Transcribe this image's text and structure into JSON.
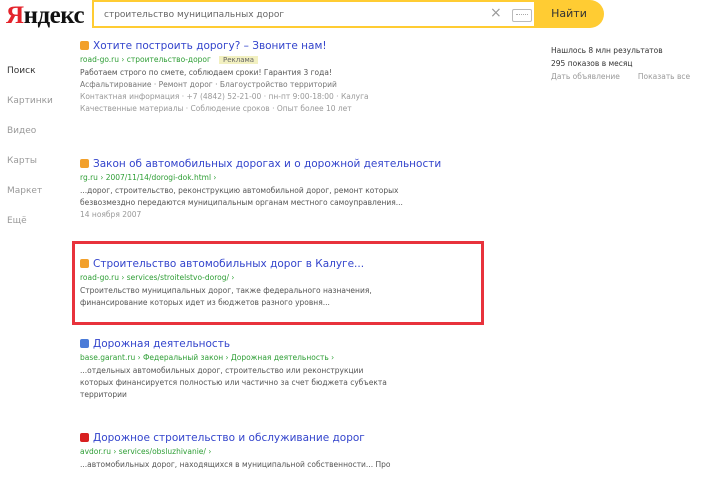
{
  "header": {
    "logo": "Яндекс",
    "search_value": "строительство муниципальных дорог",
    "search_button": "Найти"
  },
  "nav": [
    "Поиск",
    "Картинки",
    "Видео",
    "Карты",
    "Маркет",
    "Ещё"
  ],
  "side": {
    "line1": "Нашлось 8 млн результатов",
    "line2": "295 показов в месяц",
    "link1": "Дать объявление",
    "link2": "Показать все"
  },
  "results": [
    {
      "title": "Хотите построить дорогу? – Звоните нам!",
      "url": "road-go.ru › строительство-дорог",
      "badge": "Реклама",
      "desc": [
        "Работаем строго по смете, соблюдаем сроки! Гарантия 3 года!",
        "Асфальтирование · Ремонт дорог · Благоустройство территорий",
        "Контактная информация · +7 (4842) 52-21-00 · пн-пт 9:00-18:00 · Калуга",
        "Качественные материалы · Соблюдение сроков · Опыт более 10 лет"
      ],
      "favicon": "#f2a02b"
    },
    {
      "title": "Закон об автомобильных дорогах и о дорожной деятельности",
      "url": "rg.ru › 2007/11/14/dorogi-dok.html ›",
      "desc": [
        "...дорог, строительство, реконструкцию автомобильной дорог, ремонт которых",
        "безвозмездно передаются муниципальным органам местного самоуправления..."
      ],
      "date": "14 ноября 2007",
      "favicon": "#f2a02b"
    },
    {
      "title": "Строительство автомобильных дорог в Калуге...",
      "url": "road-go.ru › services/stroitelstvo-dorog/ ›",
      "desc": [
        "Строительство муниципальных дорог, также федерального назначения,",
        "финансирование которых идет из бюджетов разного уровня..."
      ],
      "favicon": "#f2a02b"
    },
    {
      "title": "Дорожная деятельность",
      "url": "base.garant.ru › Федеральный закон › Дорожная деятельность ›",
      "desc": [
        "...отдельных автомобильных дорог, строительство или реконструкции",
        "которых финансируется полностью или частично за счет бюджета субъекта",
        "территории"
      ],
      "favicon": "#4a7bd8"
    },
    {
      "title": "Дорожное строительство и обслуживание дорог",
      "url": "avdor.ru › services/obsluzhivanie/ ›",
      "desc": [
        "...автомобильных дорог, находящихся в муниципальной собственности... Про"
      ],
      "favicon": "#d82020"
    }
  ]
}
